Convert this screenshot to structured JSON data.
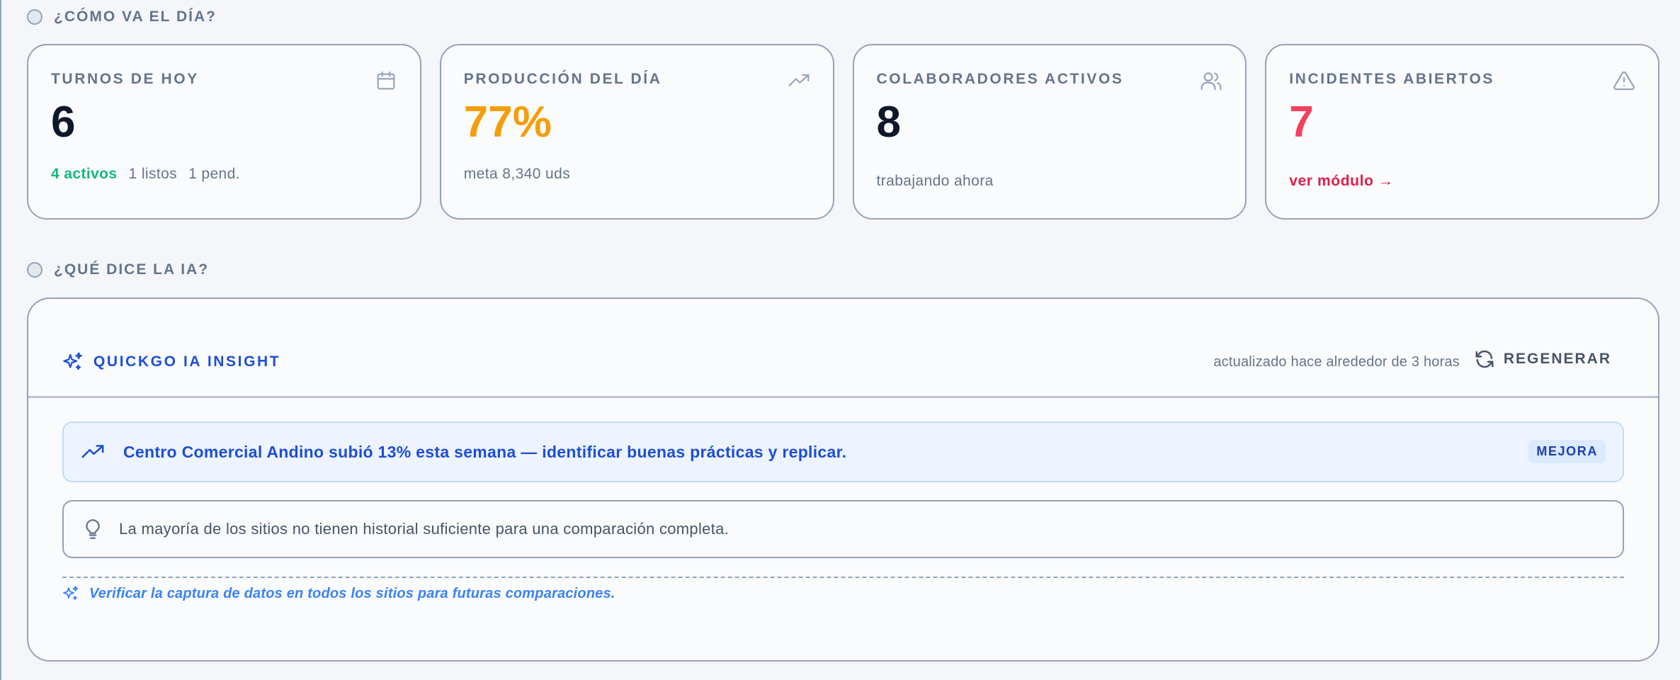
{
  "sections": {
    "day": "¿CÓMO VA EL DÍA?",
    "ai": "¿QUÉ DICE LA IA?"
  },
  "cards": {
    "shifts": {
      "label": "TURNOS DE HOY",
      "value": "6",
      "active": "4 activos",
      "ready": "1 listos",
      "pending": "1 pend.",
      "icon": "calendar-icon"
    },
    "production": {
      "label": "PRODUCCIÓN DEL DÍA",
      "value": "77%",
      "sub": "meta 8,340 uds",
      "icon": "trending-up-icon"
    },
    "collaborators": {
      "label": "COLABORADORES ACTIVOS",
      "value": "8",
      "sub": "trabajando ahora",
      "icon": "users-icon"
    },
    "incidents": {
      "label": "INCIDENTES ABIERTOS",
      "value": "7",
      "link": "ver módulo →",
      "icon": "alert-triangle-icon"
    }
  },
  "ai": {
    "brand": "QUICKGO IA INSIGHT",
    "updated": "actualizado hace alrededor de 3 horas",
    "regenerate": "REGENERAR",
    "highlight": {
      "text": "Centro Comercial Andino subió 13% esta semana — identificar buenas prácticas y replicar.",
      "tag": "MEJORA"
    },
    "note": {
      "text": "La mayoría de los sitios no tienen historial suficiente para una comparación completa."
    },
    "recommendation": "Verificar la captura de datos en todos los sitios para futuras comparaciones."
  },
  "colors": {
    "accent": "#1d4ed8",
    "success": "#10b981",
    "warning": "#f59e0b",
    "danger": "#f43f5e"
  }
}
